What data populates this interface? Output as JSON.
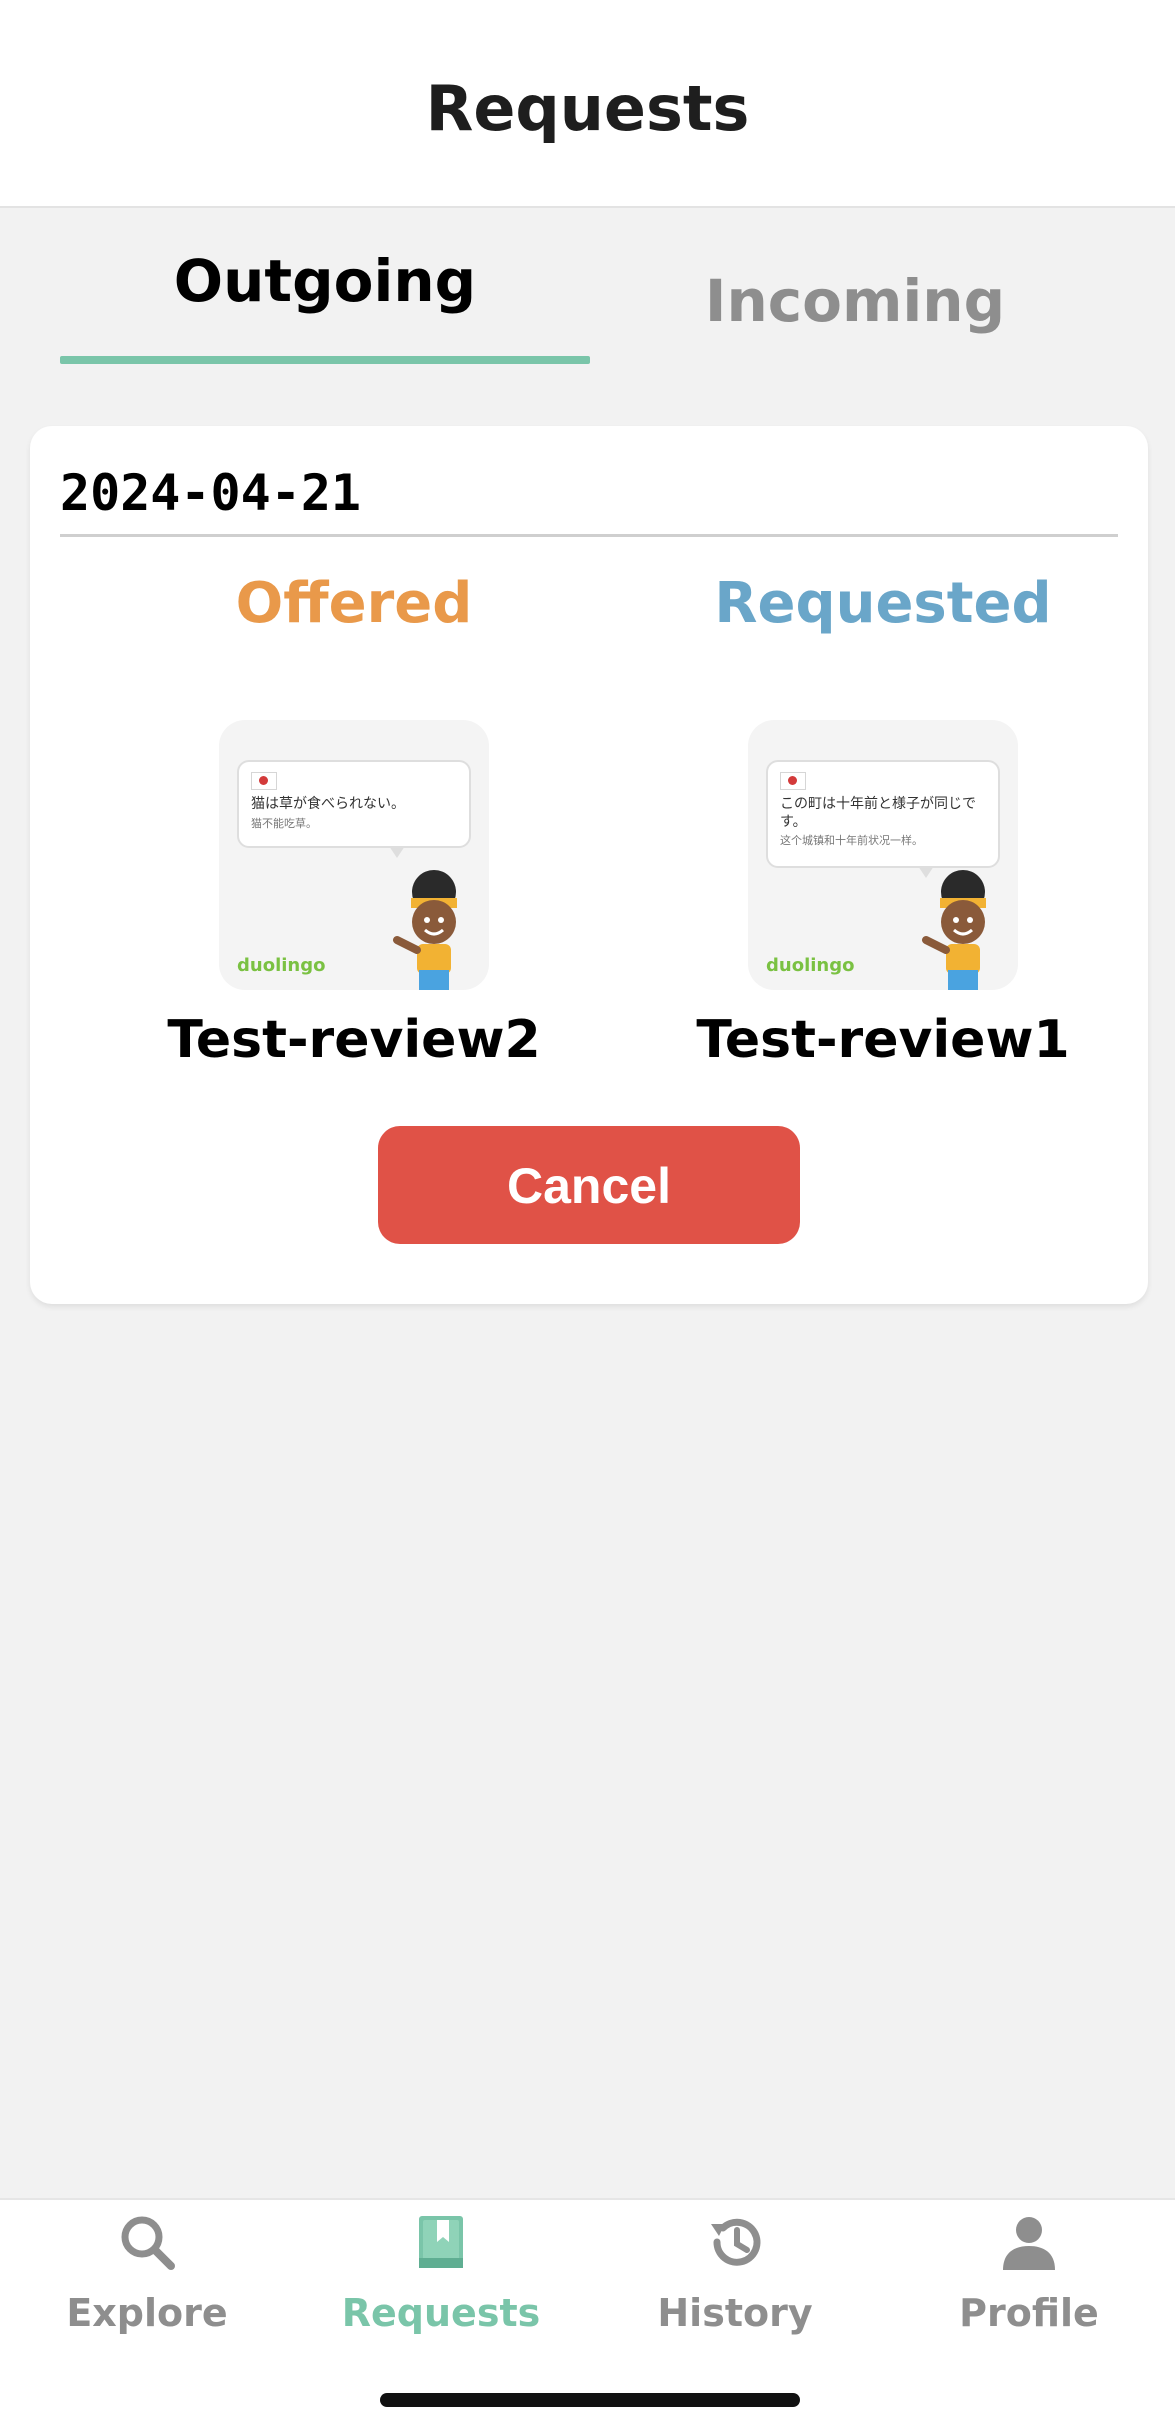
{
  "header": {
    "title": "Requests"
  },
  "tabs": [
    {
      "label": "Outgoing",
      "active": true
    },
    {
      "label": "Incoming",
      "active": false
    }
  ],
  "colors": {
    "accent": "#7ac5a9",
    "offered": "#e9994a",
    "requested": "#6aa6c9",
    "cancel": "#e05247",
    "inactive": "#8e8e8e"
  },
  "request": {
    "date": "2024-04-21",
    "offered": {
      "heading": "Offered",
      "name": "Test-review2",
      "card": {
        "jp": "猫は草が食べられない。",
        "zh": "猫不能吃草。",
        "logo": "duolingo"
      }
    },
    "requested": {
      "heading": "Requested",
      "name": "Test-review1",
      "card": {
        "jp": "この町は十年前と様子が同じです。",
        "zh": "这个城镇和十年前状况一样。",
        "logo": "duolingo"
      }
    },
    "cancel_label": "Cancel"
  },
  "nav": {
    "items": [
      {
        "label": "Explore",
        "icon": "search-icon"
      },
      {
        "label": "Requests",
        "icon": "book-icon",
        "active": true
      },
      {
        "label": "History",
        "icon": "history-icon"
      },
      {
        "label": "Profile",
        "icon": "person-icon"
      }
    ]
  }
}
